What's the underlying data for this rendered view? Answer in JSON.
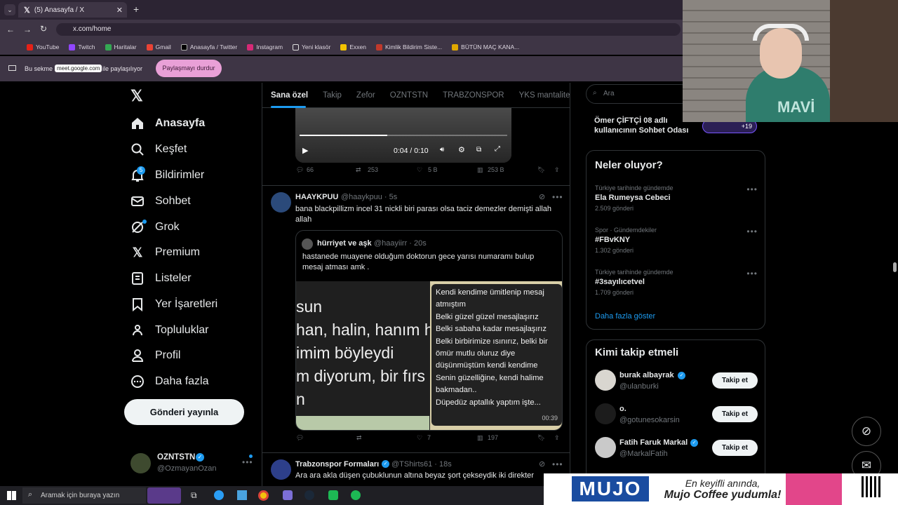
{
  "browser": {
    "tab_title": "(5) Anasayfa / X",
    "url": "x.com/home",
    "bookmarks": [
      "YouTube",
      "Twitch",
      "Haritalar",
      "Gmail",
      "Anasayfa / Twitter",
      "Instagram",
      "Yeni klasör",
      "Exxen",
      "Kimlik Bildirim Siste...",
      "BÜTÜN MAÇ KANA..."
    ],
    "share": {
      "prefix": "Bu sekme",
      "domain": "meet.google.com",
      "suffix": "ile paylaşılıyor",
      "stop": "Paylaşmayı durdur"
    }
  },
  "nav": {
    "items": [
      "Anasayfa",
      "Keşfet",
      "Bildirimler",
      "Sohbet",
      "Grok",
      "Premium",
      "Listeler",
      "Yer İşaretleri",
      "Topluluklar",
      "Profil",
      "Daha fazla"
    ],
    "notif_count": "5",
    "post_button": "Gönderi yayınla",
    "user_name": "OZNTSTN",
    "user_handle": "@OzmayanOzan"
  },
  "feed_tabs": [
    "Sana özel",
    "Takip",
    "Zefor",
    "OZNTSTN",
    "TRABZONSPOR",
    "YKS mantalite"
  ],
  "video": {
    "time": "0:04 / 0:10"
  },
  "tweet0_actions": {
    "reply": "66",
    "retweet": "253",
    "like": "5 B",
    "views": "253 B"
  },
  "tweet1": {
    "name": "HAAYKPUU",
    "handle": "@haaykpuu · 5s",
    "text": "bana blackpillizm incel 31 nickli biri parası olsa taciz demezler demişti allah allah",
    "quote_name": "hürriyet ve aşk",
    "quote_handle": "@haayiirr · 20s",
    "quote_text": "hastanede muayene olduğum doktorun gece yarısı numaramı bulup mesaj atması amk .",
    "img_lines": [
      "sun",
      "han, halin, hanım h",
      "imim böyleydi",
      "m diyorum, bir fırs",
      "n"
    ],
    "bubble_lines": [
      "Kendi kendime ümitlenip mesaj",
      "atmıştım",
      "Belki güzel güzel mesajlaşırız",
      "Belki sabaha kadar mesajlaşırız",
      "Belki birbirimize ısınırız, belki bir",
      "ömür mutlu oluruz diye",
      "düşünmüştüm kendi kendime",
      "Senin güzelliğine, kendi halime",
      "bakmadan..",
      "Düpedüz aptallık yaptım işte..."
    ],
    "bubble_time": "00:39",
    "likes": "7",
    "views": "197"
  },
  "tweet2": {
    "name": "Trabzonspor Formaları",
    "handle": "@TShirts61 · 18s",
    "text": "Ara ara akla düşen çubuklunun altına beyaz şort çekseydik iki direkter"
  },
  "right": {
    "search_placeholder": "Ara",
    "chat_line1": "Ömer ÇİFTÇİ 08 adlı",
    "chat_line2": "kullanıcının Sohbet Odası",
    "chat_count": "+19",
    "trends_title": "Neler oluyor?",
    "trends": [
      {
        "meta": "Türkiye tarihinde gündemde",
        "name": "Ela Rumeysa Cebeci",
        "count": "2.509 gönderi"
      },
      {
        "meta": "Spor · Gündemdekiler",
        "name": "#FBvKNY",
        "count": "1.302 gönderi"
      },
      {
        "meta": "Türkiye tarihinde gündemde",
        "name": "#3sayılıcetvel",
        "count": "1.709 gönderi"
      }
    ],
    "show_more": "Daha fazla göster",
    "follow_title": "Kimi takip etmeli",
    "follow": [
      {
        "name": "burak albayrak",
        "handle": "@ulanburki"
      },
      {
        "name": "o.",
        "handle": "@gotunesokarsin"
      },
      {
        "name": "Fatih Faruk Markal",
        "handle": "@MarkalFatih"
      }
    ],
    "follow_label": "Takip et"
  },
  "taskbar": {
    "search": "Aramak için buraya yazın"
  },
  "ad": {
    "brand": "MUJO",
    "line1": "En keyifli anında,",
    "line2": "Mujo Coffee yudumla!"
  },
  "colors": {
    "accent": "#1d9bf0",
    "bg": "#000000",
    "chrome": "#3e3545",
    "stop_btn": "#e9a0d7"
  }
}
